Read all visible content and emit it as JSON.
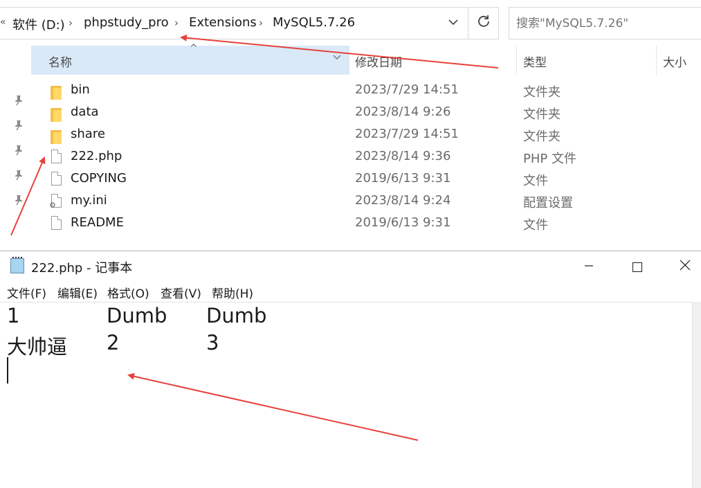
{
  "explorer": {
    "breadcrumb": {
      "overflow": "«",
      "items": [
        "软件 (D:)",
        "phpstudy_pro",
        "Extensions",
        "MySQL5.7.26"
      ],
      "separator": "›"
    },
    "search_placeholder": "搜索\"MySQL5.7.26\"",
    "columns": {
      "name": "名称",
      "date": "修改日期",
      "type": "类型",
      "size": "大小"
    },
    "files": [
      {
        "name": "bin",
        "date": "2023/7/29 14:51",
        "type": "文件夹",
        "icon": "folder-icon"
      },
      {
        "name": "data",
        "date": "2023/8/14 9:26",
        "type": "文件夹",
        "icon": "folder-icon"
      },
      {
        "name": "share",
        "date": "2023/7/29 14:51",
        "type": "文件夹",
        "icon": "folder-icon"
      },
      {
        "name": "222.php",
        "date": "2023/8/14 9:36",
        "type": "PHP 文件",
        "icon": "file-icon"
      },
      {
        "name": "COPYING",
        "date": "2019/6/13 9:31",
        "type": "文件",
        "icon": "file-icon"
      },
      {
        "name": "my.ini",
        "date": "2023/8/14 9:24",
        "type": "配置设置",
        "icon": "ini-file-icon"
      },
      {
        "name": "README",
        "date": "2019/6/13 9:31",
        "type": "文件",
        "icon": "file-icon"
      }
    ]
  },
  "notepad": {
    "title": "222.php - 记事本",
    "menu": [
      "文件(F)",
      "编辑(E)",
      "格式(O)",
      "查看(V)",
      "帮助(H)"
    ],
    "content": [
      [
        "1",
        "Dumb",
        "Dumb"
      ],
      [
        "大帅逼",
        "2",
        "3"
      ]
    ]
  },
  "colors": {
    "selected_column": "#d9e9f8",
    "annotation_arrow": "#e8403a",
    "folder": "#ffd866"
  }
}
